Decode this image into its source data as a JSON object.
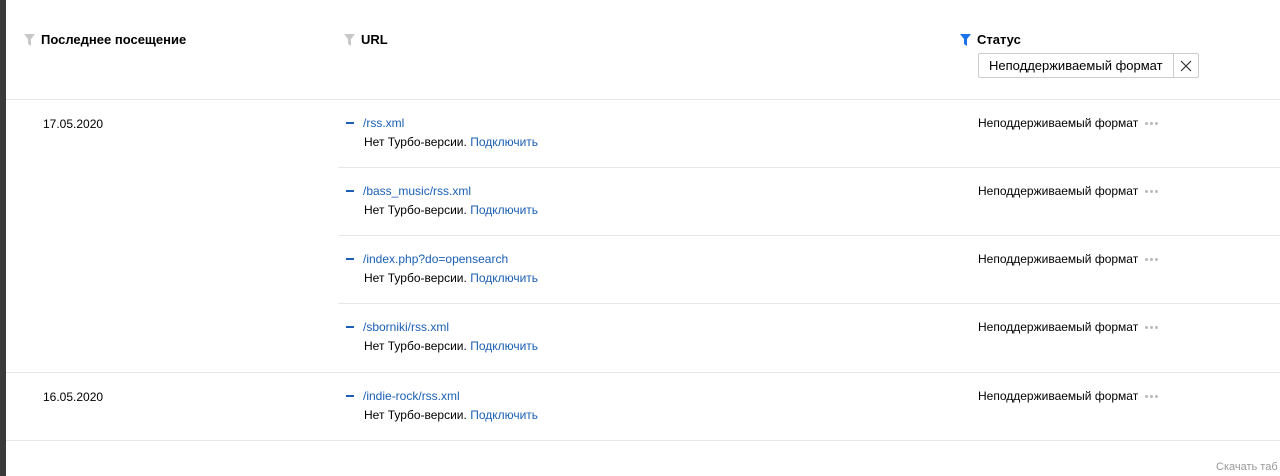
{
  "header": {
    "date_label": "Последнее посещение",
    "url_label": "URL",
    "status_label": "Статус",
    "status_filter_value": "Неподдерживаемый формат",
    "filter_active_color": "#1a73e8",
    "filter_inactive_color": "#c8c8c8"
  },
  "groups": [
    {
      "date": "17.05.2020",
      "rows": [
        {
          "url": "/rss.xml",
          "note": "Нет Турбо-версии.",
          "action": "Подключить",
          "status": "Неподдерживаемый формат"
        },
        {
          "url": "/bass_music/rss.xml",
          "note": "Нет Турбо-версии.",
          "action": "Подключить",
          "status": "Неподдерживаемый формат"
        },
        {
          "url": "/index.php?do=opensearch",
          "note": "Нет Турбо-версии.",
          "action": "Подключить",
          "status": "Неподдерживаемый формат"
        },
        {
          "url": "/sborniki/rss.xml",
          "note": "Нет Турбо-версии.",
          "action": "Подключить",
          "status": "Неподдерживаемый формат"
        }
      ]
    },
    {
      "date": "16.05.2020",
      "rows": [
        {
          "url": "/indie-rock/rss.xml",
          "note": "Нет Турбо-версии.",
          "action": "Подключить",
          "status": "Неподдерживаемый формат"
        }
      ]
    }
  ],
  "footer": {
    "download_label": "Скачать таб"
  }
}
